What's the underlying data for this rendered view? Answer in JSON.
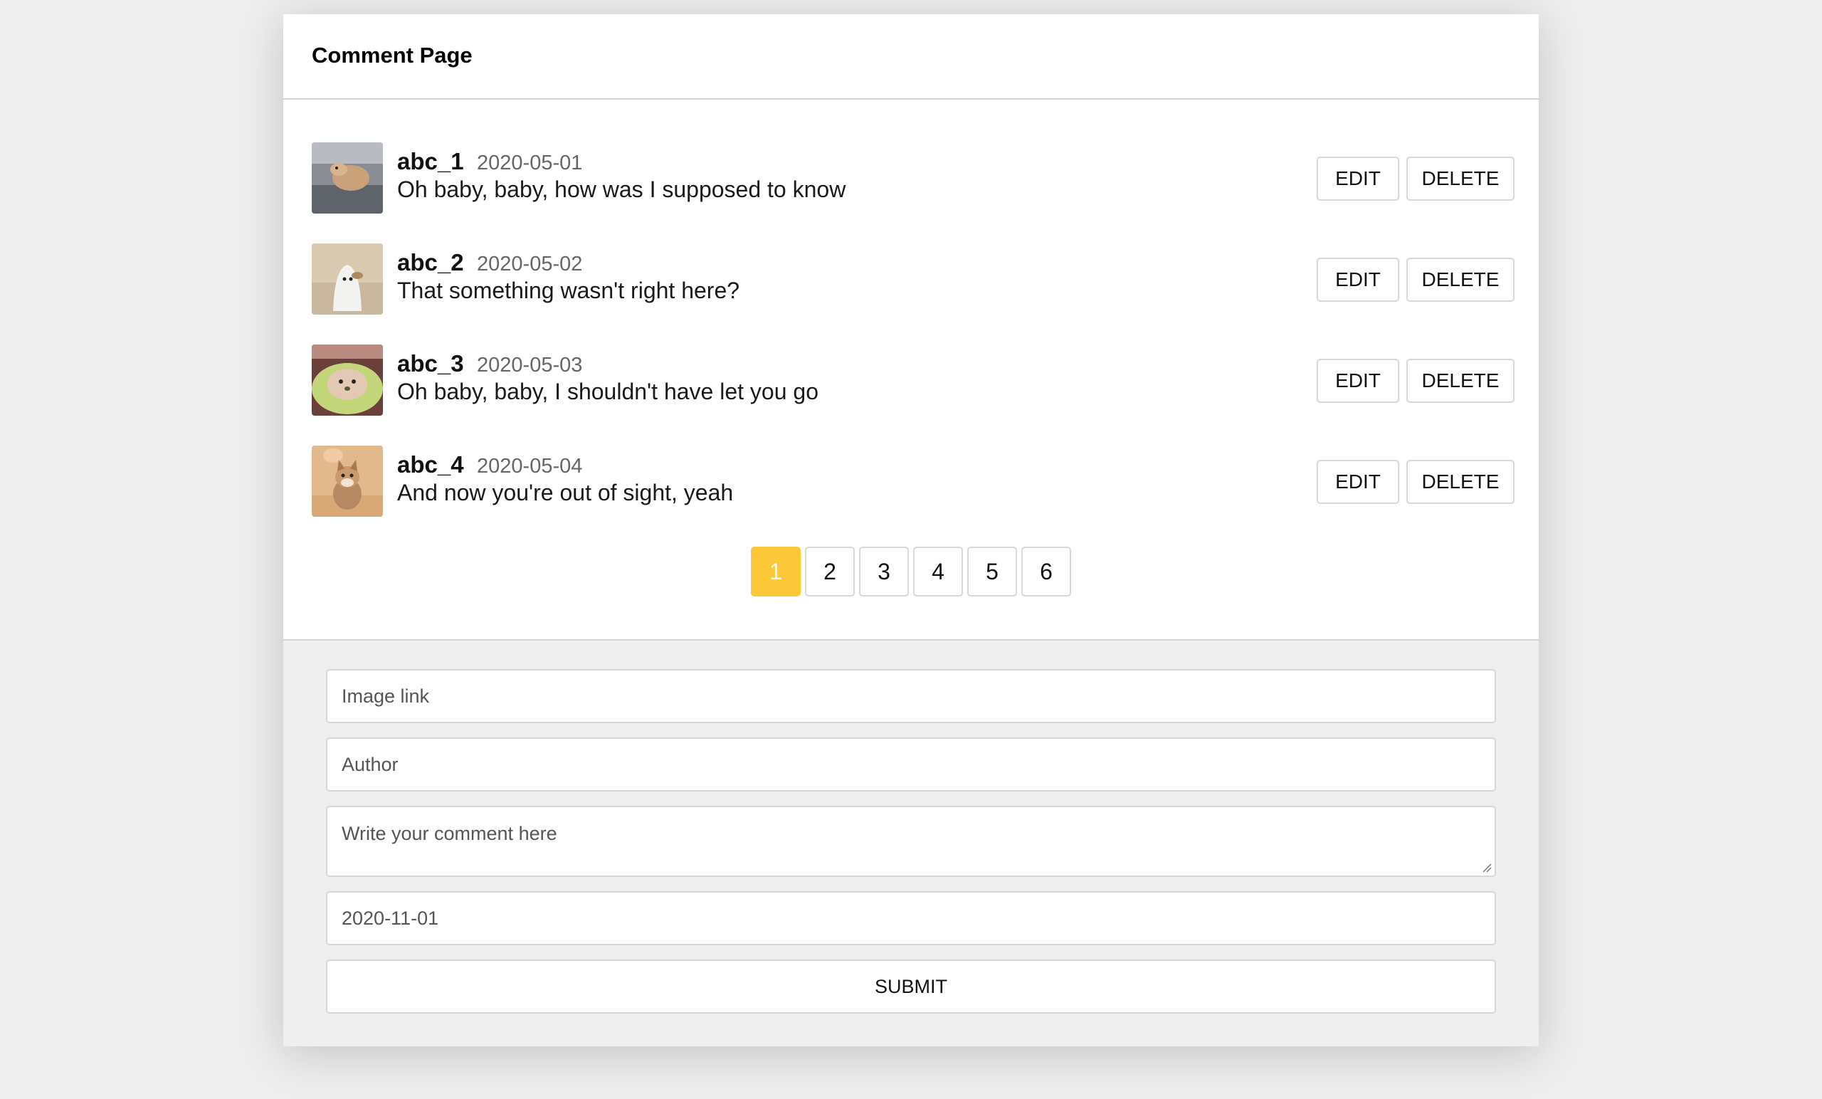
{
  "header": {
    "title": "Comment Page"
  },
  "comments": [
    {
      "author": "abc_1",
      "date": "2020-05-01",
      "text": "Oh baby, baby, how was I supposed to know",
      "avatar": "dog-photo"
    },
    {
      "author": "abc_2",
      "date": "2020-05-02",
      "text": "That something wasn't right here?",
      "avatar": "ghost-dog-photo"
    },
    {
      "author": "abc_3",
      "date": "2020-05-03",
      "text": "Oh baby, baby, I shouldn't have let you go",
      "avatar": "dog-in-avocado-photo"
    },
    {
      "author": "abc_4",
      "date": "2020-05-04",
      "text": "And now you're out of sight, yeah",
      "avatar": "corgi-puppy-photo"
    }
  ],
  "buttons": {
    "edit": "EDIT",
    "delete": "DELETE"
  },
  "pagination": {
    "pages": [
      "1",
      "2",
      "3",
      "4",
      "5",
      "6"
    ],
    "current": "1",
    "accent": "#fcc83a"
  },
  "form": {
    "image_placeholder": "Image link",
    "author_placeholder": "Author",
    "comment_placeholder": "Write your comment here",
    "date_value": "2020-11-01",
    "submit_label": "SUBMIT"
  }
}
